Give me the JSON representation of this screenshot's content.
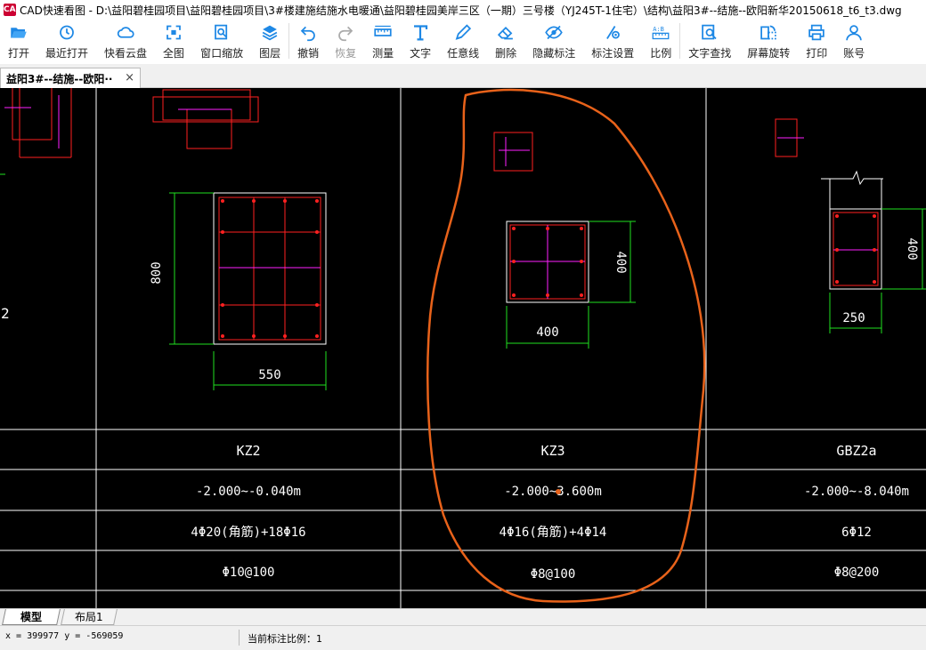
{
  "window": {
    "app_icon_text": "CAD",
    "title": "CAD快速看图 - D:\\益阳碧桂园项目\\益阳碧桂园项目\\3#楼建施结施水电暖通\\益阳碧桂园美岸三区（一期）三号楼（YJ245T-1住宅）\\结构\\益阳3#--结施--欧阳新华20150618_t6_t3.dwg"
  },
  "toolbar": {
    "items": [
      {
        "label": "打开",
        "icon": "folder-open-icon"
      },
      {
        "label": "最近打开",
        "icon": "recent-clock-icon"
      },
      {
        "label": "快看云盘",
        "icon": "cloud-icon"
      },
      {
        "label": "全图",
        "icon": "fit-all-icon"
      },
      {
        "label": "窗口缩放",
        "icon": "zoom-window-icon"
      },
      {
        "label": "图层",
        "icon": "layers-icon"
      },
      {
        "label": "撤销",
        "icon": "undo-icon"
      },
      {
        "label": "恢复",
        "icon": "redo-icon"
      },
      {
        "label": "测量",
        "icon": "ruler-icon"
      },
      {
        "label": "文字",
        "icon": "text-tool-icon"
      },
      {
        "label": "任意线",
        "icon": "pen-icon"
      },
      {
        "label": "删除",
        "icon": "eraser-icon"
      },
      {
        "label": "隐藏标注",
        "icon": "eye-icon"
      },
      {
        "label": "标注设置",
        "icon": "annotation-settings-icon"
      },
      {
        "label": "比例",
        "icon": "scale-icon"
      },
      {
        "label": "文字查找",
        "icon": "text-search-icon"
      },
      {
        "label": "屏幕旋转",
        "icon": "rotate-screen-icon"
      },
      {
        "label": "打印",
        "icon": "printer-icon"
      },
      {
        "label": "账号",
        "icon": "account-icon"
      }
    ]
  },
  "document_tab": {
    "label": "益阳3#--结施--欧阳··",
    "close": "×"
  },
  "drawing": {
    "dims": {
      "kz2_height": "800",
      "kz2_width": "550",
      "kz3_height": "400",
      "kz3_width": "400",
      "gbz_height": "400",
      "gbz_width": "250",
      "left_edge_mark": "2"
    },
    "table": {
      "names": [
        "KZ2",
        "KZ3",
        "GBZ2a"
      ],
      "elevations": [
        "-2.000~-0.040m",
        "-2.000~3.600m",
        "-2.000~-8.040m"
      ],
      "longitudinal_bars": [
        "4Φ20(角筋)+18Φ16",
        "4Φ16(角筋)+4Φ14",
        "6Φ12"
      ],
      "stirrups": [
        "Φ10@100",
        "Φ8@100",
        "Φ8@200"
      ]
    },
    "colors": {
      "background": "#000000",
      "grid_line": "#ffffff",
      "column_outline": "#ffffff",
      "rebar_red": "#ff2020",
      "rebar_magenta": "#ff20ff",
      "dimension_green": "#20e020",
      "annotation_orange": "#e8621a"
    }
  },
  "layout_tabs": [
    "模型",
    "布局1"
  ],
  "status": {
    "coords": "x = 399977  y = -569059",
    "scale": "当前标注比例：1"
  }
}
